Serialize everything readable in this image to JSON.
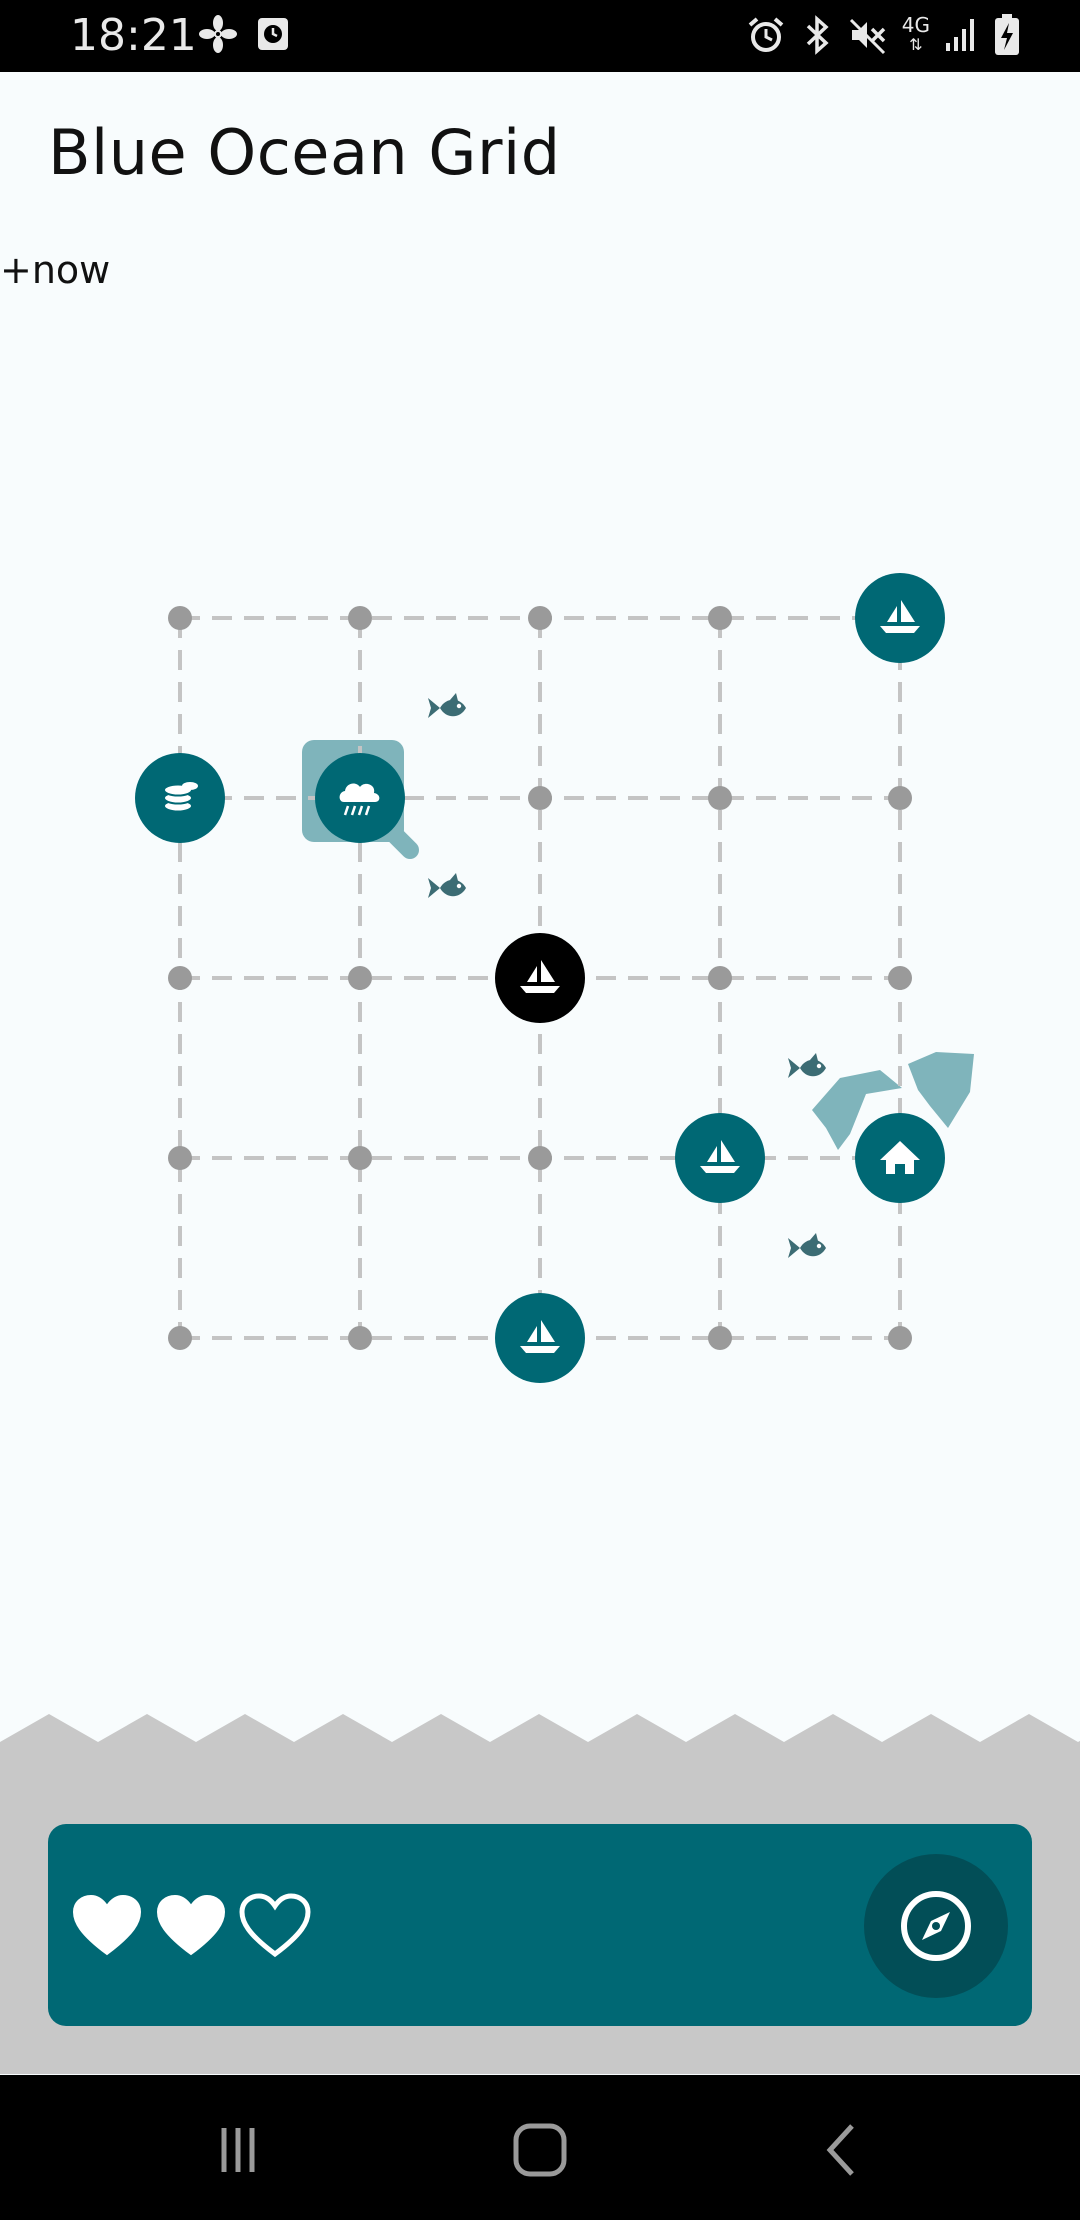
{
  "status_bar": {
    "time": "18:21",
    "network_label": "4G",
    "left_icons": [
      "fan-icon",
      "clock-app-icon"
    ],
    "right_icons": [
      "alarm-icon",
      "bluetooth-icon",
      "mute-icon",
      "network-4g-icon",
      "signal-icon",
      "battery-charging-icon"
    ]
  },
  "header": {
    "title": "Blue Ocean Grid",
    "timer": "+now"
  },
  "board": {
    "cols": 5,
    "rows": 5,
    "tokens": [
      {
        "col": 4,
        "row": 0,
        "icon": "sailboat-icon",
        "style": "teal"
      },
      {
        "col": 0,
        "row": 1,
        "icon": "coins-icon",
        "style": "teal"
      },
      {
        "col": 1,
        "row": 1,
        "icon": "rain-cloud-icon",
        "style": "teal"
      },
      {
        "col": 2,
        "row": 2,
        "icon": "sailboat-icon",
        "style": "black"
      },
      {
        "col": 3,
        "row": 3,
        "icon": "sailboat-icon",
        "style": "teal"
      },
      {
        "col": 4,
        "row": 3,
        "icon": "home-icon",
        "style": "teal"
      },
      {
        "col": 2,
        "row": 4,
        "icon": "sailboat-icon",
        "style": "teal"
      }
    ],
    "fish": [
      {
        "col": 1.5,
        "row": 0.5
      },
      {
        "col": 1.5,
        "row": 1.5
      },
      {
        "col": 3.5,
        "row": 2.5
      },
      {
        "col": 3.5,
        "row": 3.5
      }
    ]
  },
  "bottom": {
    "lives_total": 3,
    "lives_remaining": 2
  },
  "colors": {
    "teal": "#006874",
    "dark_teal": "#024e57",
    "light_teal": "#7fb4bb",
    "fish": "#3c6c74",
    "grid_dot": "#9a9a9a",
    "grid_line": "#c4c4c4",
    "sea_gray": "#c8c8c8",
    "background": "#f8fcfd"
  }
}
